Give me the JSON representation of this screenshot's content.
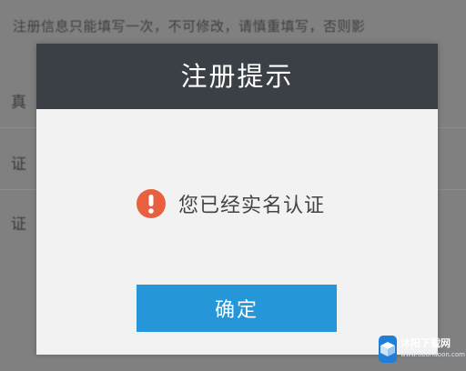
{
  "background": {
    "notice": "注册信息只能填写一次，不可修改，请慎重填写，否则影",
    "labels": [
      "真",
      "证",
      "证"
    ]
  },
  "dialog": {
    "title": "注册提示",
    "message": "您已经实名认证",
    "confirm_label": "确定",
    "icon": "warning-icon",
    "colors": {
      "header": "#3b3f46",
      "body": "#f2f2f2",
      "button": "#2596d8",
      "icon": "#e8603f"
    }
  },
  "watermark": {
    "title": "沐阳下载网",
    "subtitle": "www.ubandoon.com"
  }
}
